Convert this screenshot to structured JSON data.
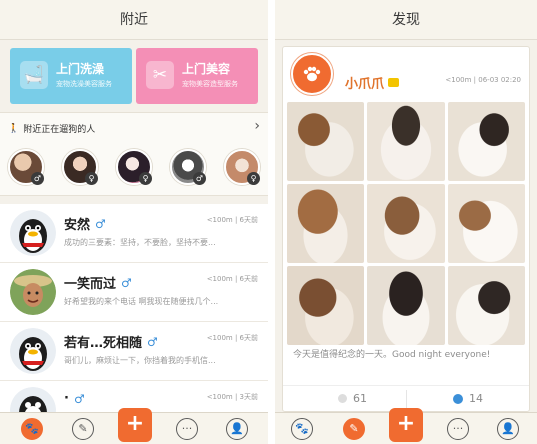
{
  "screen_nearby": {
    "title": "附近",
    "services": [
      {
        "title": "上门洗澡",
        "subtitle": "宠物洗澡美容服务"
      },
      {
        "title": "上门美容",
        "subtitle": "宠物美容造型服务"
      }
    ],
    "nearby_header": "附近正在遛狗的人",
    "users": [
      {
        "name": "安然",
        "distance_time": "<100m | 6天前",
        "message": "成功的三要素：坚持，不要脸，坚持不要..."
      },
      {
        "name": "一笑而过",
        "distance_time": "<100m | 6天前",
        "message": "好希望我的来个电话 啊我现在随便找几个..."
      },
      {
        "name": "若有…死相随",
        "distance_time": "<100m | 6天前",
        "message": "哥们儿，麻烦让一下，你挡着我的手机信..."
      },
      {
        "name": "·",
        "distance_time": "<100m | 3天前",
        "message": ""
      }
    ]
  },
  "screen_discover": {
    "title": "发现",
    "post": {
      "author": "小爪爪",
      "meta": "<100m | 06-03 02:20",
      "text": "今天是值得纪念的一天。Good night everyone!",
      "likes": "61",
      "comments": "14"
    }
  },
  "colors": {
    "accent": "#f06b30",
    "wash": "#79cde8",
    "beauty": "#f48fb6",
    "male": "#3b8fd8"
  }
}
